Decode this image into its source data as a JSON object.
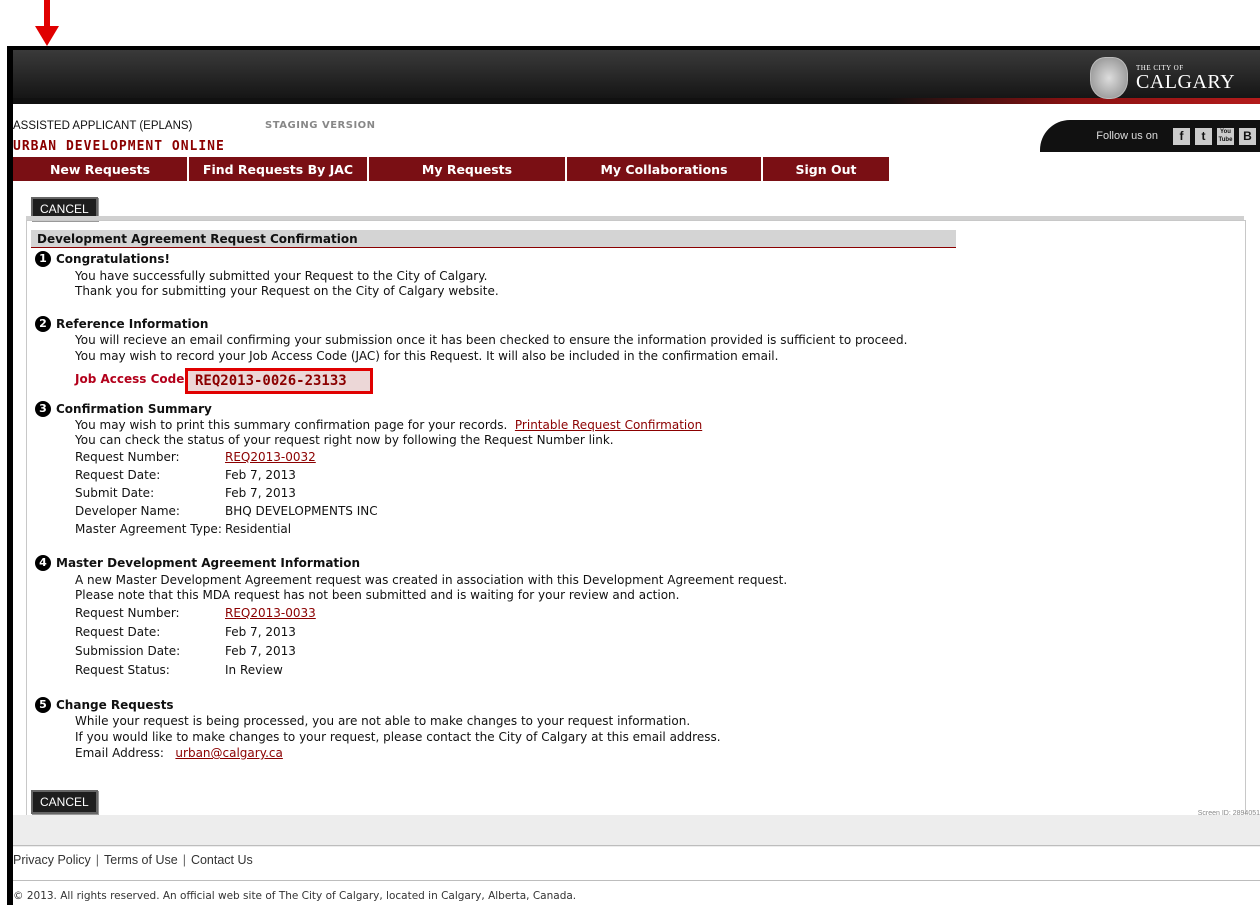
{
  "header": {
    "logo_small": "THE CITY OF",
    "logo_big": "CALGARY",
    "follow_label": "Follow us on",
    "social": [
      "f",
      "t",
      "You Tube",
      "B"
    ]
  },
  "role": "ASSISTED APPLICANT (EPLANS)",
  "staging": "STAGING VERSION",
  "app_title": "URBAN DEVELOPMENT ONLINE",
  "nav": [
    "New Requests",
    "Find Requests By JAC",
    "My Requests",
    "My Collaborations",
    "Sign Out"
  ],
  "cancel_label": "CANCEL",
  "section_title": "Development Agreement Request Confirmation",
  "s1": {
    "num": "1",
    "title": "Congratulations!",
    "line1": "You have successfully submitted your Request to the City of Calgary.",
    "line2": "Thank you for submitting your Request on the City of Calgary website."
  },
  "s2": {
    "num": "2",
    "title": "Reference Information",
    "line1": "You will recieve an email confirming your submission once it has been checked to ensure the information provided is sufficient to proceed.",
    "line2": "You may wish to record your Job Access Code (JAC) for this Request. It will also be included in the confirmation email.",
    "jac_label": "Job Access Code:",
    "jac_value": "REQ2013-0026-23133"
  },
  "s3": {
    "num": "3",
    "title": "Confirmation Summary",
    "line1": "You may wish to print this summary confirmation page for your records.",
    "print_link": "Printable Request Confirmation",
    "line2": "You can check the status of your request right now by following the Request Number link.",
    "rows": [
      {
        "label": "Request Number:",
        "value": "REQ2013-0032"
      },
      {
        "label": "Request Date:",
        "value": "Feb 7, 2013"
      },
      {
        "label": "Submit Date:",
        "value": "Feb 7, 2013"
      },
      {
        "label": "Developer Name:",
        "value": "BHQ DEVELOPMENTS INC"
      },
      {
        "label": "Master Agreement Type:",
        "value": "Residential"
      }
    ]
  },
  "s4": {
    "num": "4",
    "title": "Master Development Agreement Information",
    "line1": "A new Master Development Agreement request was created in association with this Development Agreement request.",
    "line2": "Please note that this MDA request has not been submitted and is waiting for your review and action.",
    "rows": [
      {
        "label": "Request Number:",
        "value": "REQ2013-0033"
      },
      {
        "label": "Request Date:",
        "value": "Feb 7, 2013"
      },
      {
        "label": "Submission Date:",
        "value": "Feb 7, 2013"
      },
      {
        "label": "Request Status:",
        "value": "In Review"
      }
    ]
  },
  "s5": {
    "num": "5",
    "title": "Change Requests",
    "line1": "While your request is being processed, you are not able to make changes to your request information.",
    "line2": "If you would like to make changes to your request, please contact the City of Calgary at this email address.",
    "email_label": "Email Address:",
    "email": "urban@calgary.ca"
  },
  "screen_id": "Screen ID: 2894051",
  "footer": {
    "links": [
      "Privacy Policy",
      "Terms of Use",
      "Contact Us"
    ],
    "copyright": "© 2013. All rights reserved. An official web site of The City of Calgary, located in Calgary, Alberta, Canada."
  },
  "colors": {
    "brand_red": "#7a0f14",
    "annotation_red": "#e00000"
  }
}
